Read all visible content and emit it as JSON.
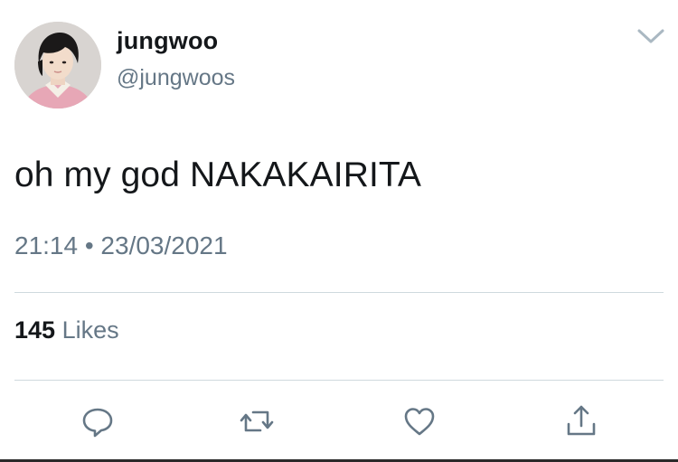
{
  "tweet": {
    "author_name": "jungwoo",
    "author_handle": "@jungwoos",
    "text": "oh my god NAKAKAIRITA",
    "timestamp": "21:14 • 23/03/2021",
    "likes_count": "145",
    "likes_label": "Likes"
  },
  "icons": {
    "menu": "chevron-down-icon",
    "reply": "reply-icon",
    "retweet": "retweet-icon",
    "like": "heart-icon",
    "share": "share-icon"
  },
  "colors": {
    "text_primary": "#14171a",
    "text_secondary": "#657786",
    "divider": "#cfd9de",
    "icon": "#657786"
  }
}
